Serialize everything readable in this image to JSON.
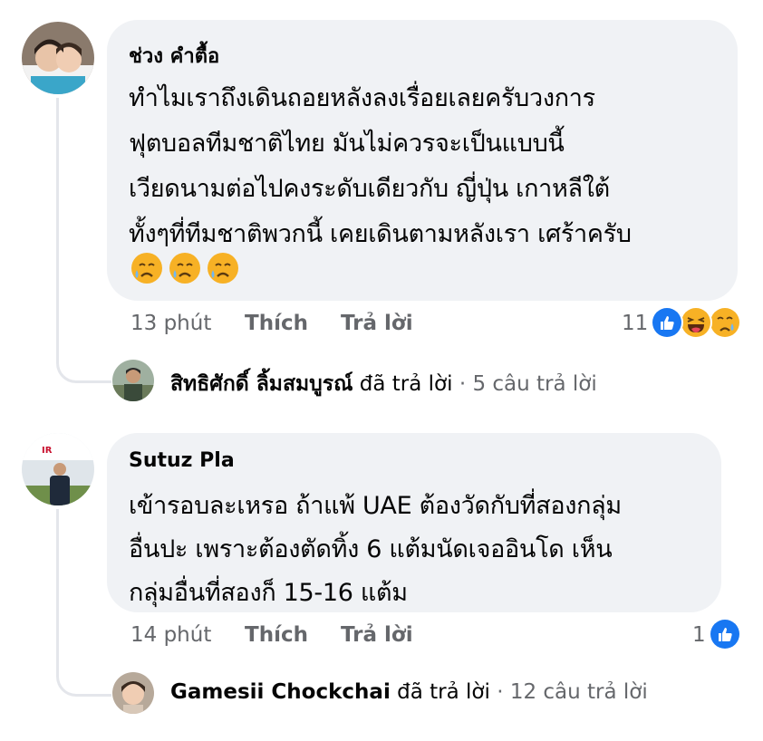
{
  "comments": [
    {
      "author": "ช่วง คำตื้อ",
      "text_lines": [
        "ทำไมเราถึงเดินถอยหลังลงเรื่อยเลยครับวงการ",
        "ฟุตบอลทีมชาติไทย มันไม่ควรจะเป็นแบบนี้",
        "เวียดนามต่อไปคงระดับเดียวกับ ญี่ปุ่น เกาหลีใต้",
        "ทั้งๆที่ทีมชาติพวกนี้ เคยเดินตามหลังเรา เศร้าครับ"
      ],
      "emojis": [
        "sad-face-emoji",
        "sad-face-emoji",
        "sad-face-emoji"
      ],
      "time": "13 phút",
      "like_label": "Thích",
      "reply_label": "Trả lời",
      "reaction_count": "11",
      "reactions": [
        "like",
        "haha",
        "sad"
      ],
      "reply_summary": {
        "name": "สิทธิศักดิ์ ลิ้มสมบูรณ์",
        "action": "đã trả lời",
        "separator": "·",
        "count": "5 câu trả lời"
      }
    },
    {
      "author": "Sutuz Pla",
      "text_lines": [
        "เข้ารอบละเหรอ ถ้าแพ้ UAE ต้องวัดกับที่สองกลุ่ม",
        "อื่นปะ เพราะต้องตัดทิ้ง 6 แต้มนัดเจออินโด เห็น",
        "กลุ่มอื่นที่สองก็ 15-16 แต้ม"
      ],
      "time": "14 phút",
      "like_label": "Thích",
      "reply_label": "Trả lời",
      "reaction_count": "1",
      "reactions": [
        "like"
      ],
      "reply_summary": {
        "name": "Gamesii Chockchai",
        "action": "đã trả lời",
        "separator": "·",
        "count": "12 câu trả lời"
      }
    }
  ],
  "colors": {
    "bubble": "#f0f2f5",
    "meta_text": "#65676b",
    "like_blue": "#1877f2",
    "emoji_yellow": "#f7b125"
  }
}
